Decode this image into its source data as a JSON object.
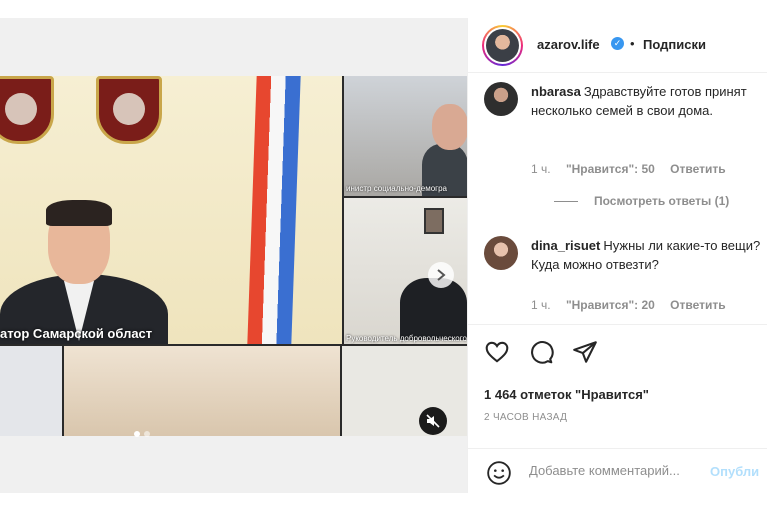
{
  "post": {
    "username": "azarov.life",
    "separator": "•",
    "follow_label": "Подписки",
    "verified_icon": "verified-badge-icon"
  },
  "video": {
    "caption_main": "атор Самарской област",
    "caption_r1": "инистр социально-демогра",
    "caption_r2": "Руководитель добровольческого",
    "slide_count": 2,
    "active_slide": 1
  },
  "comments": [
    {
      "username": "nbarasa",
      "text": "Здравствуйте готов принят несколько семей в свои дома.",
      "time": "1 ч.",
      "likes": "\"Нравится\": 50",
      "reply_label": "Ответить"
    },
    {
      "username": "dina_risuet",
      "text": "Нужны ли какие-то вещи? Куда можно отвезти?",
      "time": "1 ч.",
      "likes": "\"Нравится\": 20",
      "reply_label": "Ответить"
    }
  ],
  "view_replies": "Посмотреть ответы (1)",
  "actions": {
    "icons": [
      "heart-icon",
      "comment-icon",
      "share-icon"
    ],
    "likes_count": "1 464 отметок \"Нравится\"",
    "time_ago": "2 ЧАСОВ НАЗАД"
  },
  "add_comment": {
    "placeholder": "Добавьте комментарий...",
    "publish_label": "Опубли"
  },
  "colors": {
    "accent": "#3897f0",
    "publish_disabled": "#b2dffc",
    "secondary_text": "#8e8e8e",
    "primary_text": "#262626"
  }
}
